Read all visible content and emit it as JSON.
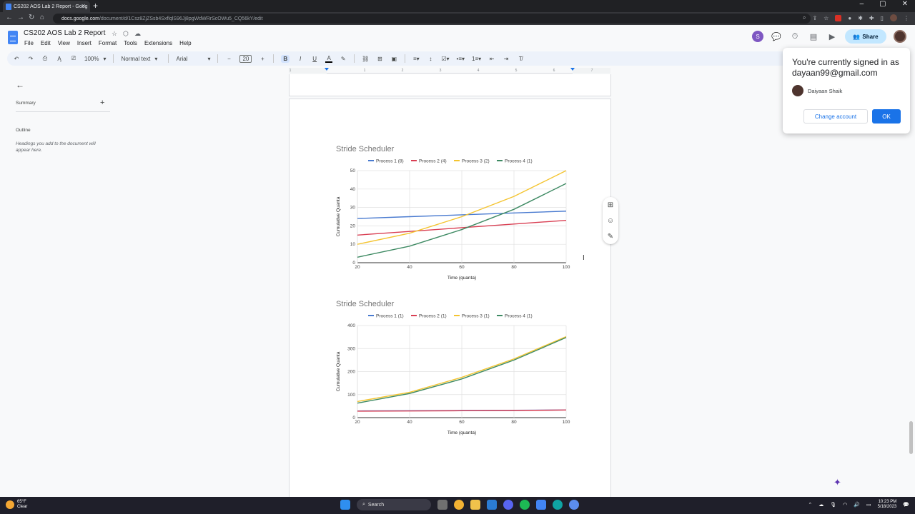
{
  "browser": {
    "tab_title": "CS202 AOS Lab 2 Report - Goog",
    "url_host": "docs.google.com",
    "url_path": "/document/d/1Csz8ZjZSsb4SxflqlS96Jj8pgWdWRrScOWu5_CQ56kY/edit"
  },
  "doc": {
    "title": "CS202 AOS Lab 2 Report",
    "menu": [
      "File",
      "Edit",
      "View",
      "Insert",
      "Format",
      "Tools",
      "Extensions",
      "Help"
    ],
    "share_label": "Share",
    "collab_initial": "S"
  },
  "toolbar": {
    "zoom": "100%",
    "style": "Normal text",
    "font": "Arial",
    "font_size": "20",
    "bold": "B",
    "italic": "I",
    "underline": "U",
    "text_color": "A"
  },
  "outline_panel": {
    "summary_label": "Summary",
    "outline_label": "Outline",
    "hint": "Headings you add to the document will appear here."
  },
  "ruler_numbers": [
    "1",
    "1",
    "2",
    "3",
    "4",
    "5",
    "6",
    "7"
  ],
  "account_popup": {
    "line1": "You're currently signed in as",
    "email": "dayaan99@gmail.com",
    "user_name": "Daiyaan Shaik",
    "change_label": "Change account",
    "ok_label": "OK"
  },
  "taskbar": {
    "temp": "65°F",
    "condition": "Clear",
    "search_label": "Search",
    "time": "10:23 PM",
    "date": "5/18/2023"
  },
  "colors": {
    "series1": "#4a7bd0",
    "series2": "#d93f53",
    "series3": "#f4c430",
    "series4": "#3e8a63"
  },
  "chart_data": [
    {
      "type": "line",
      "title": "Stride Scheduler",
      "xlabel": "Time (quanta)",
      "ylabel": "Cumulative Quanta",
      "xlim": [
        20,
        100
      ],
      "ylim": [
        0,
        50
      ],
      "x_ticks": [
        "20",
        "40",
        "60",
        "80",
        "100"
      ],
      "y_ticks": [
        "0",
        "10",
        "20",
        "30",
        "40",
        "50"
      ],
      "legend_position": "top",
      "grid": true,
      "x": [
        20,
        40,
        60,
        80,
        100
      ],
      "series": [
        {
          "name": "Process 1  (8)",
          "values": [
            24,
            25,
            26,
            27,
            28
          ]
        },
        {
          "name": "Process 2  (4)",
          "values": [
            15,
            17,
            19,
            21,
            23
          ]
        },
        {
          "name": "Process 3  (2)",
          "values": [
            10,
            16,
            25,
            36,
            50
          ]
        },
        {
          "name": "Process 4  (1)",
          "values": [
            3,
            9,
            18,
            29,
            43
          ]
        }
      ]
    },
    {
      "type": "line",
      "title": "Stride Scheduler",
      "xlabel": "Time (quanta)",
      "ylabel": "Cumulative Quanta",
      "xlim": [
        20,
        100
      ],
      "ylim": [
        0,
        400
      ],
      "x_ticks": [
        "20",
        "40",
        "60",
        "80",
        "100"
      ],
      "y_ticks": [
        "0",
        "100",
        "200",
        "300",
        "400"
      ],
      "legend_position": "top",
      "grid": true,
      "x": [
        20,
        40,
        60,
        80,
        100
      ],
      "series": [
        {
          "name": "Process 1  (1)",
          "values": [
            29,
            30,
            31,
            32,
            33
          ]
        },
        {
          "name": "Process 2  (1)",
          "values": [
            28,
            29,
            30,
            31,
            33
          ]
        },
        {
          "name": "Process 3  (1)",
          "values": [
            70,
            110,
            175,
            255,
            352
          ]
        },
        {
          "name": "Process 4  (1)",
          "values": [
            63,
            105,
            168,
            250,
            348
          ]
        }
      ]
    }
  ]
}
